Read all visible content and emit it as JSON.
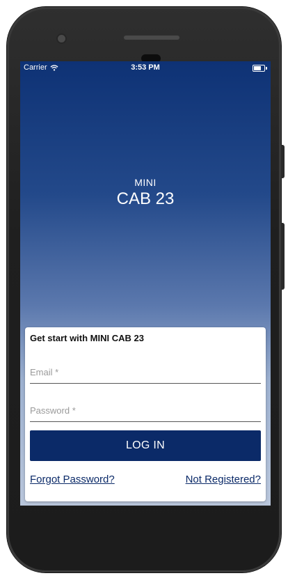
{
  "status_bar": {
    "carrier": "Carrier",
    "time": "3:53 PM",
    "icons": [
      "wifi-icon",
      "battery-icon"
    ]
  },
  "brand": {
    "top_line": "MINI",
    "name": "CAB 23"
  },
  "login_card": {
    "title": "Get start with MINI CAB 23",
    "email": {
      "value": "",
      "placeholder": "Email *"
    },
    "password": {
      "value": "",
      "placeholder": "Password *"
    },
    "login_label": "LOG IN",
    "forgot_password_label": "Forgot Password?",
    "not_registered_label": "Not Registered?"
  },
  "colors": {
    "primary": "#0b2a68",
    "gradient_top": "#0e3275",
    "gradient_bottom": "#b9c6db",
    "device_body": "#1f1f1f"
  }
}
